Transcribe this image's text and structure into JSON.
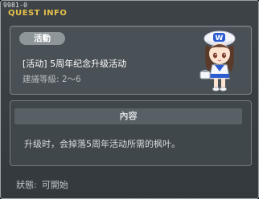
{
  "window": {
    "quest_id": "9981-0",
    "title": "QUEST INFO"
  },
  "quest": {
    "category_badge": "活動",
    "name": "[活动] 5周年纪念升级活动",
    "level_requirement": "建議等級: 2～6",
    "npc_icon": "maple-girl-npc-portrait"
  },
  "content": {
    "header": "內容",
    "description": "升级时，会掉落5周年活动所需的枫叶。"
  },
  "status": {
    "label": "狀態:",
    "value": "可開始"
  },
  "colors": {
    "title": "#e8c04a",
    "panel": "#4a5156",
    "background": "#3a4044"
  }
}
